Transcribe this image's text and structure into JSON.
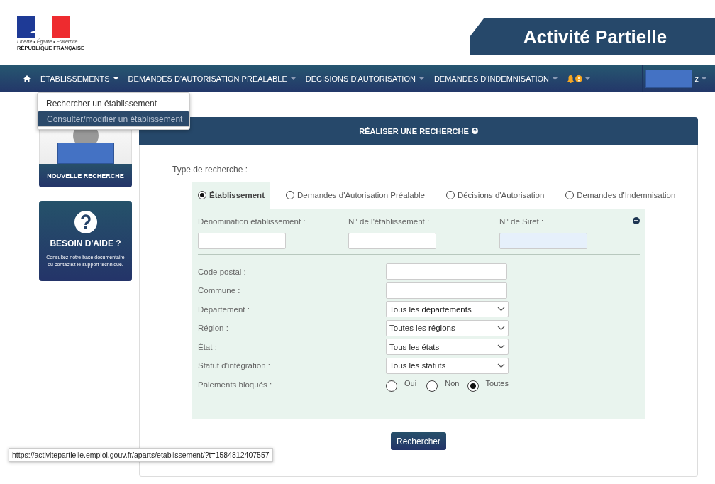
{
  "header": {
    "motto": "Liberté • Égalité • Fraternité",
    "republic": "RÉPUBLIQUE FRANÇAISE",
    "title": "Activité Partielle"
  },
  "nav": {
    "items": [
      {
        "label": "ÉTABLISSEMENTS",
        "open": true
      },
      {
        "label": "DEMANDES D'AUTORISATION PRÉALABLE",
        "open": false
      },
      {
        "label": "DÉCISIONS D'AUTORISATION",
        "open": false
      },
      {
        "label": "DEMANDES D'INDEMNISATION",
        "open": false
      }
    ],
    "user": "z"
  },
  "menu": [
    {
      "label": "Rechercher un établissement",
      "selected": false
    },
    {
      "label": "Consulter/modifier un établissement",
      "selected": true
    }
  ],
  "sidebar": {
    "new_search": "NOUVELLE RECHERCHE",
    "help_title": "BESOIN D'AIDE ?",
    "help_text": "Consultez notre base documentaire ou contactez le support technique."
  },
  "panel": {
    "title": "RÉALISER UNE RECHERCHE",
    "type_label": "Type de recherche :",
    "types": [
      {
        "label": "Établissement",
        "selected": true
      },
      {
        "label": "Demandes d'Autorisation Préalable",
        "selected": false
      },
      {
        "label": "Décisions d'Autorisation",
        "selected": false
      },
      {
        "label": "Demandes d'Indemnisation",
        "selected": false
      }
    ],
    "top_fields": [
      {
        "label": "Dénomination établissement :",
        "highlighted": false
      },
      {
        "label": "N° de l'établissement :",
        "highlighted": false
      },
      {
        "label": "N° de Siret :",
        "highlighted": true
      }
    ],
    "fields": [
      {
        "label": "Code postal :",
        "kind": "text"
      },
      {
        "label": "Commune :",
        "kind": "text"
      },
      {
        "label": "Département :",
        "kind": "select",
        "value": "Tous les départements"
      },
      {
        "label": "Région :",
        "kind": "select",
        "value": "Toutes les régions"
      },
      {
        "label": "État :",
        "kind": "select",
        "value": "Tous les états"
      },
      {
        "label": "Statut d'intégration :",
        "kind": "select",
        "value": "Tous les statuts"
      }
    ],
    "payment": {
      "label": "Paiements bloqués :",
      "options": [
        {
          "label": "Oui",
          "selected": false
        },
        {
          "label": "Non",
          "selected": false
        },
        {
          "label": "Toutes",
          "selected": true
        }
      ]
    },
    "submit": "Rechercher"
  },
  "status_url": "https://activitepartielle.emploi.gouv.fr/aparts/etablissement/?t=1584812407557"
}
